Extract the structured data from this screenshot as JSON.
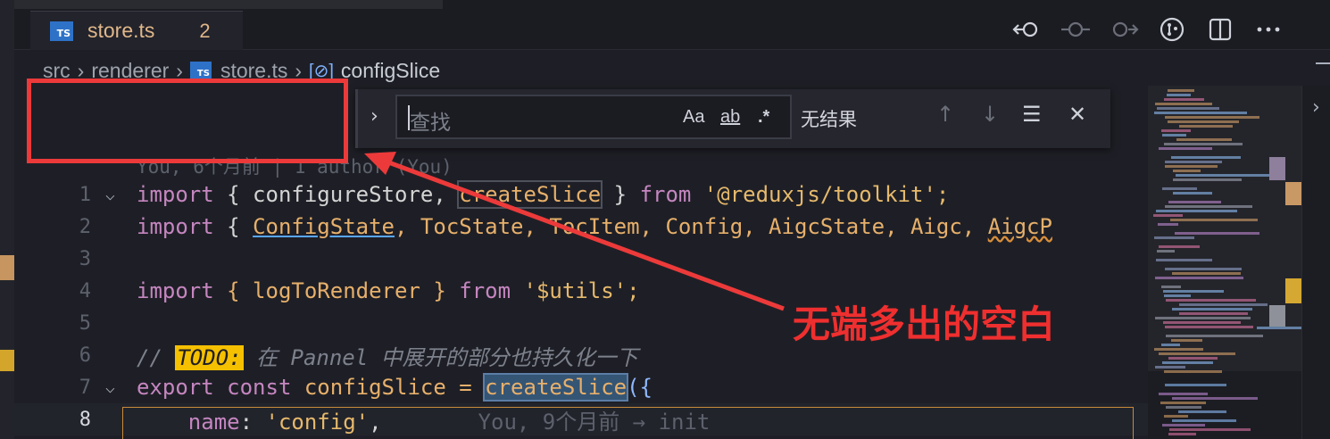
{
  "tab": {
    "badge": "TS",
    "filename": "store.ts",
    "problem_count": "2"
  },
  "toolbar": {
    "icons": [
      "go-back-icon",
      "commit-icon",
      "go-forward-icon",
      "git-compare-icon",
      "split-editor-icon",
      "more-actions-icon"
    ]
  },
  "breadcrumb": {
    "items": [
      "src",
      "renderer",
      "store.ts",
      "configSlice"
    ],
    "file_badge": "TS"
  },
  "find": {
    "placeholder": "查找",
    "match_case": "Aa",
    "whole_word": "ab",
    "regex": ".*",
    "result": "无结果"
  },
  "editor": {
    "codelens": "You, 6个月前 | 1 author (You)",
    "lines": [
      {
        "n": "1"
      },
      {
        "n": "2"
      },
      {
        "n": "3"
      },
      {
        "n": "4"
      },
      {
        "n": "5"
      },
      {
        "n": "6"
      },
      {
        "n": "7"
      },
      {
        "n": "8"
      }
    ],
    "line1": {
      "kw": "import",
      "a": " { configureStore, ",
      "b": "createSlice",
      "c": " } ",
      "d": "from",
      "e": " '@reduxjs/toolkit';"
    },
    "line2": {
      "kw": "import",
      "a": " { ",
      "b": "ConfigState",
      "c": ", TocState, TocItem, Config, AigcState, Aigc, ",
      "d": "AigcP"
    },
    "line4": {
      "kw": "import",
      "a": " { logToRenderer } ",
      "d": "from",
      "e": " '$utils';"
    },
    "line6": {
      "a": "// ",
      "todo": "TODO:",
      "b": " 在 Pannel 中展开的部分也持久化一下"
    },
    "line7": {
      "kw": "export",
      "kw2": " const",
      "a": " configSlice = ",
      "b": "createSlice",
      "c": "({"
    },
    "line8": {
      "a": "    name",
      "b": ": ",
      "c": "'config'",
      "d": ",",
      "blame": "You, 9个月前 → init"
    }
  },
  "annotation": {
    "text": "无端多出的空白"
  }
}
